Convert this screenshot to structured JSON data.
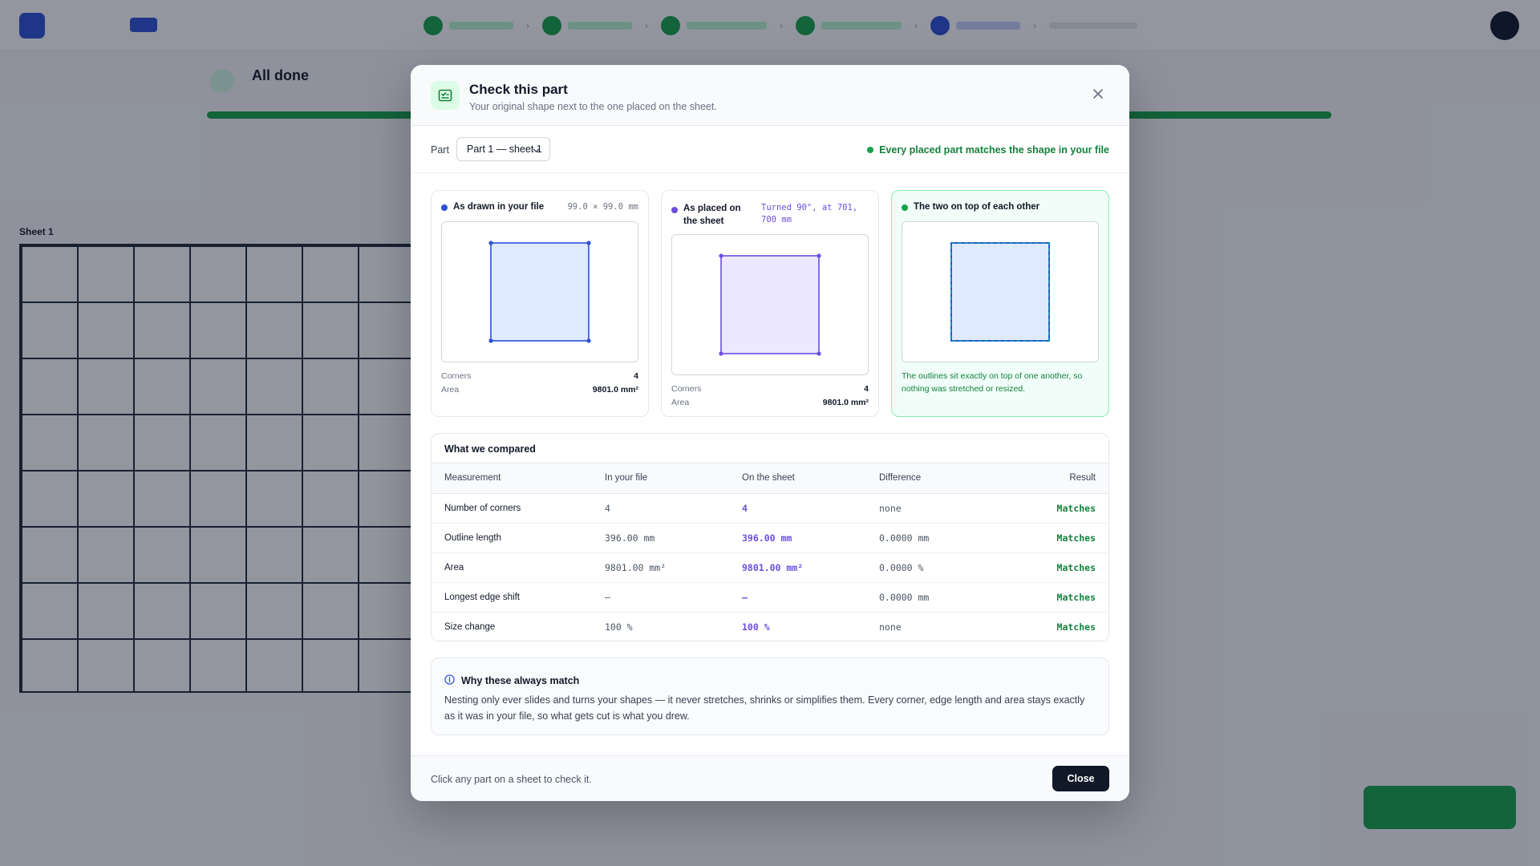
{
  "modal": {
    "title": "Check this part",
    "subtitle": "Your original shape next to the one placed on the sheet.",
    "part_label": "Part",
    "part_selected": "Part 1 — sheet 1",
    "match_status": "Every placed part matches the shape in your file",
    "panels": {
      "original": {
        "heading": "As drawn in your file",
        "dims": "99.0 × 99.0 mm",
        "corners_label": "Corners",
        "corners_value": "4",
        "area_label": "Area",
        "area_value": "9801.0 mm²"
      },
      "placed": {
        "heading": "As placed on the sheet",
        "dims": "Turned 90°, at 701, 700 mm",
        "corners_label": "Corners",
        "corners_value": "4",
        "area_label": "Area",
        "area_value": "9801.0 mm²"
      },
      "overlay": {
        "heading": "The two on top of each other",
        "note": "The outlines sit exactly on top of one another, so nothing was stretched or resized."
      }
    },
    "comparison": {
      "title": "What we compared",
      "columns": [
        "Measurement",
        "In your file",
        "On the sheet",
        "Difference",
        "Result"
      ],
      "rows": [
        [
          "Number of corners",
          "4",
          "4",
          "none",
          "Matches"
        ],
        [
          "Outline length",
          "396.00 mm",
          "396.00 mm",
          "0.0000 mm",
          "Matches"
        ],
        [
          "Area",
          "9801.00 mm²",
          "9801.00 mm²",
          "0.0000 %",
          "Matches"
        ],
        [
          "Longest edge shift",
          "—",
          "—",
          "0.0000 mm",
          "Matches"
        ],
        [
          "Size change",
          "100 %",
          "100 %",
          "none",
          "Matches"
        ]
      ]
    },
    "why": {
      "title": "Why these always match",
      "text": "Nesting only ever slides and turns your shapes — it never stretches, shrinks or simplifies them. Every corner, edge length and area stays exactly as it was in your file, so what gets cut is what you drew."
    },
    "footer_hint": "Click any part on a sheet to check it.",
    "close_label": "Close"
  },
  "background": {
    "status_title": "All done",
    "sheet_label": "Sheet 1"
  },
  "colors": {
    "accent_green": "#16a34a",
    "accent_blue": "#2c4fd6",
    "placed_purple": "#6d4ee0",
    "overlay_teal": "#0e9aa7"
  }
}
